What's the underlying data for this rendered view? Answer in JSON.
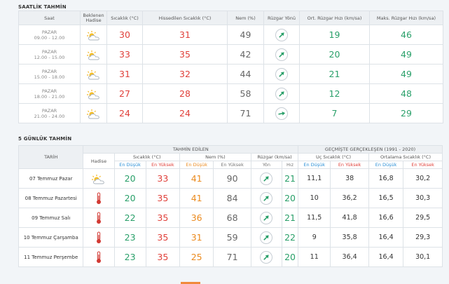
{
  "hourly": {
    "title": "SAATLİK TAHMİN",
    "headers": {
      "time": "Saat",
      "expected": "Beklenen Hadise",
      "temp": "Sıcaklık (°C)",
      "feels": "Hissedilen Sıcaklık (°C)",
      "humidity": "Nem (%)",
      "wind_dir": "Rüzgar Yönü",
      "avg_wind": "Ort. Rüzgar Hızı (km/sa)",
      "max_wind": "Maks. Rüzgar Hızı (km/sa)"
    },
    "rows": [
      {
        "day": "PAZAR",
        "period": "09.00 - 12.00",
        "icon": "partly-cloudy-icon",
        "temp": "30",
        "feels": "31",
        "humidity": "49",
        "wind_rotation": 45,
        "avg_wind": "19",
        "max_wind": "46"
      },
      {
        "day": "PAZAR",
        "period": "12.00 - 15.00",
        "icon": "partly-cloudy-icon",
        "temp": "33",
        "feels": "35",
        "humidity": "42",
        "wind_rotation": 45,
        "avg_wind": "20",
        "max_wind": "49"
      },
      {
        "day": "PAZAR",
        "period": "15.00 - 18.00",
        "icon": "partly-cloudy-icon",
        "temp": "31",
        "feels": "32",
        "humidity": "44",
        "wind_rotation": 45,
        "avg_wind": "21",
        "max_wind": "49"
      },
      {
        "day": "PAZAR",
        "period": "18.00 - 21.00",
        "icon": "partly-cloudy-icon",
        "temp": "27",
        "feels": "28",
        "humidity": "58",
        "wind_rotation": 45,
        "avg_wind": "12",
        "max_wind": "48"
      },
      {
        "day": "PAZAR",
        "period": "21.00 - 24.00",
        "icon": "partly-cloudy-icon",
        "temp": "24",
        "feels": "24",
        "humidity": "71",
        "wind_rotation": 80,
        "avg_wind": "7",
        "max_wind": "29"
      }
    ]
  },
  "daily": {
    "title": "5 GÜNLÜK TAHMİN",
    "headers": {
      "date": "TARİH",
      "forecast": "TAHMİN EDİLEN",
      "history": "GEÇMİŞTE GERÇEKLEŞEN (1991 - 2020)",
      "event": "Hadise",
      "temp": "Sıcaklık (°C)",
      "humidity": "Nem (%)",
      "wind": "Rüzgar (km/sa)",
      "extreme_temp": "Uç Sıcaklık (°C)",
      "avg_temp": "Ortalama Sıcaklık (°C)",
      "low": "En Düşük",
      "high": "En Yüksek",
      "direction": "Yön",
      "speed": "Hız"
    },
    "rows": [
      {
        "date": "07 Temmuz Pazar",
        "icon": "partly-cloudy-icon",
        "tmin": "20",
        "tmax": "33",
        "hmin": "41",
        "hmax": "90",
        "wind_rotation": 45,
        "wind_speed": "21",
        "ext_min": "11,1",
        "ext_max": "38",
        "avg_min": "16,8",
        "avg_max": "30,2"
      },
      {
        "date": "08 Temmuz Pazartesi",
        "icon": "thermometer-icon",
        "tmin": "20",
        "tmax": "35",
        "hmin": "41",
        "hmax": "84",
        "wind_rotation": 45,
        "wind_speed": "20",
        "ext_min": "10",
        "ext_max": "36,2",
        "avg_min": "16,5",
        "avg_max": "30,3"
      },
      {
        "date": "09 Temmuz Salı",
        "icon": "thermometer-icon",
        "tmin": "22",
        "tmax": "35",
        "hmin": "36",
        "hmax": "68",
        "wind_rotation": 45,
        "wind_speed": "21",
        "ext_min": "11,5",
        "ext_max": "41,8",
        "avg_min": "16,6",
        "avg_max": "29,5"
      },
      {
        "date": "10 Temmuz Çarşamba",
        "icon": "thermometer-icon",
        "tmin": "23",
        "tmax": "35",
        "hmin": "31",
        "hmax": "59",
        "wind_rotation": 45,
        "wind_speed": "22",
        "ext_min": "9",
        "ext_max": "35,8",
        "avg_min": "16,4",
        "avg_max": "29,3"
      },
      {
        "date": "11 Temmuz Perşembe",
        "icon": "thermometer-icon",
        "tmin": "23",
        "tmax": "35",
        "hmin": "25",
        "hmax": "71",
        "wind_rotation": 45,
        "wind_speed": "20",
        "ext_min": "11",
        "ext_max": "36,4",
        "avg_min": "16,4",
        "avg_max": "30,1"
      }
    ]
  }
}
